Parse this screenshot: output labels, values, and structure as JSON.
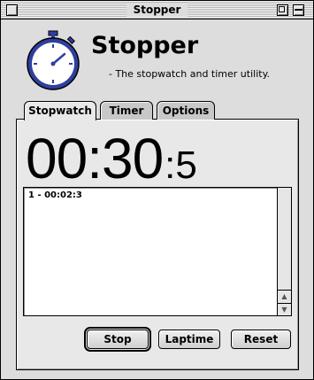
{
  "window": {
    "title": "Stopper"
  },
  "header": {
    "app_name": "Stopper",
    "subtitle": "- The stopwatch and timer utility."
  },
  "tabs": [
    {
      "label": "Stopwatch",
      "active": true
    },
    {
      "label": "Timer",
      "active": false
    },
    {
      "label": "Options",
      "active": false
    }
  ],
  "display": {
    "main": "00:30",
    "separator": ":",
    "tenths": "5"
  },
  "laps": [
    "1 - 00:02:3"
  ],
  "buttons": {
    "stop": "Stop",
    "laptime": "Laptime",
    "reset": "Reset"
  },
  "icons": {
    "logo": "stopwatch-icon",
    "scroll_up": "arrow-up-icon",
    "scroll_down": "arrow-down-icon"
  },
  "colors": {
    "logo_blue": "#2f3f9f",
    "window_gray": "#dddddd"
  }
}
